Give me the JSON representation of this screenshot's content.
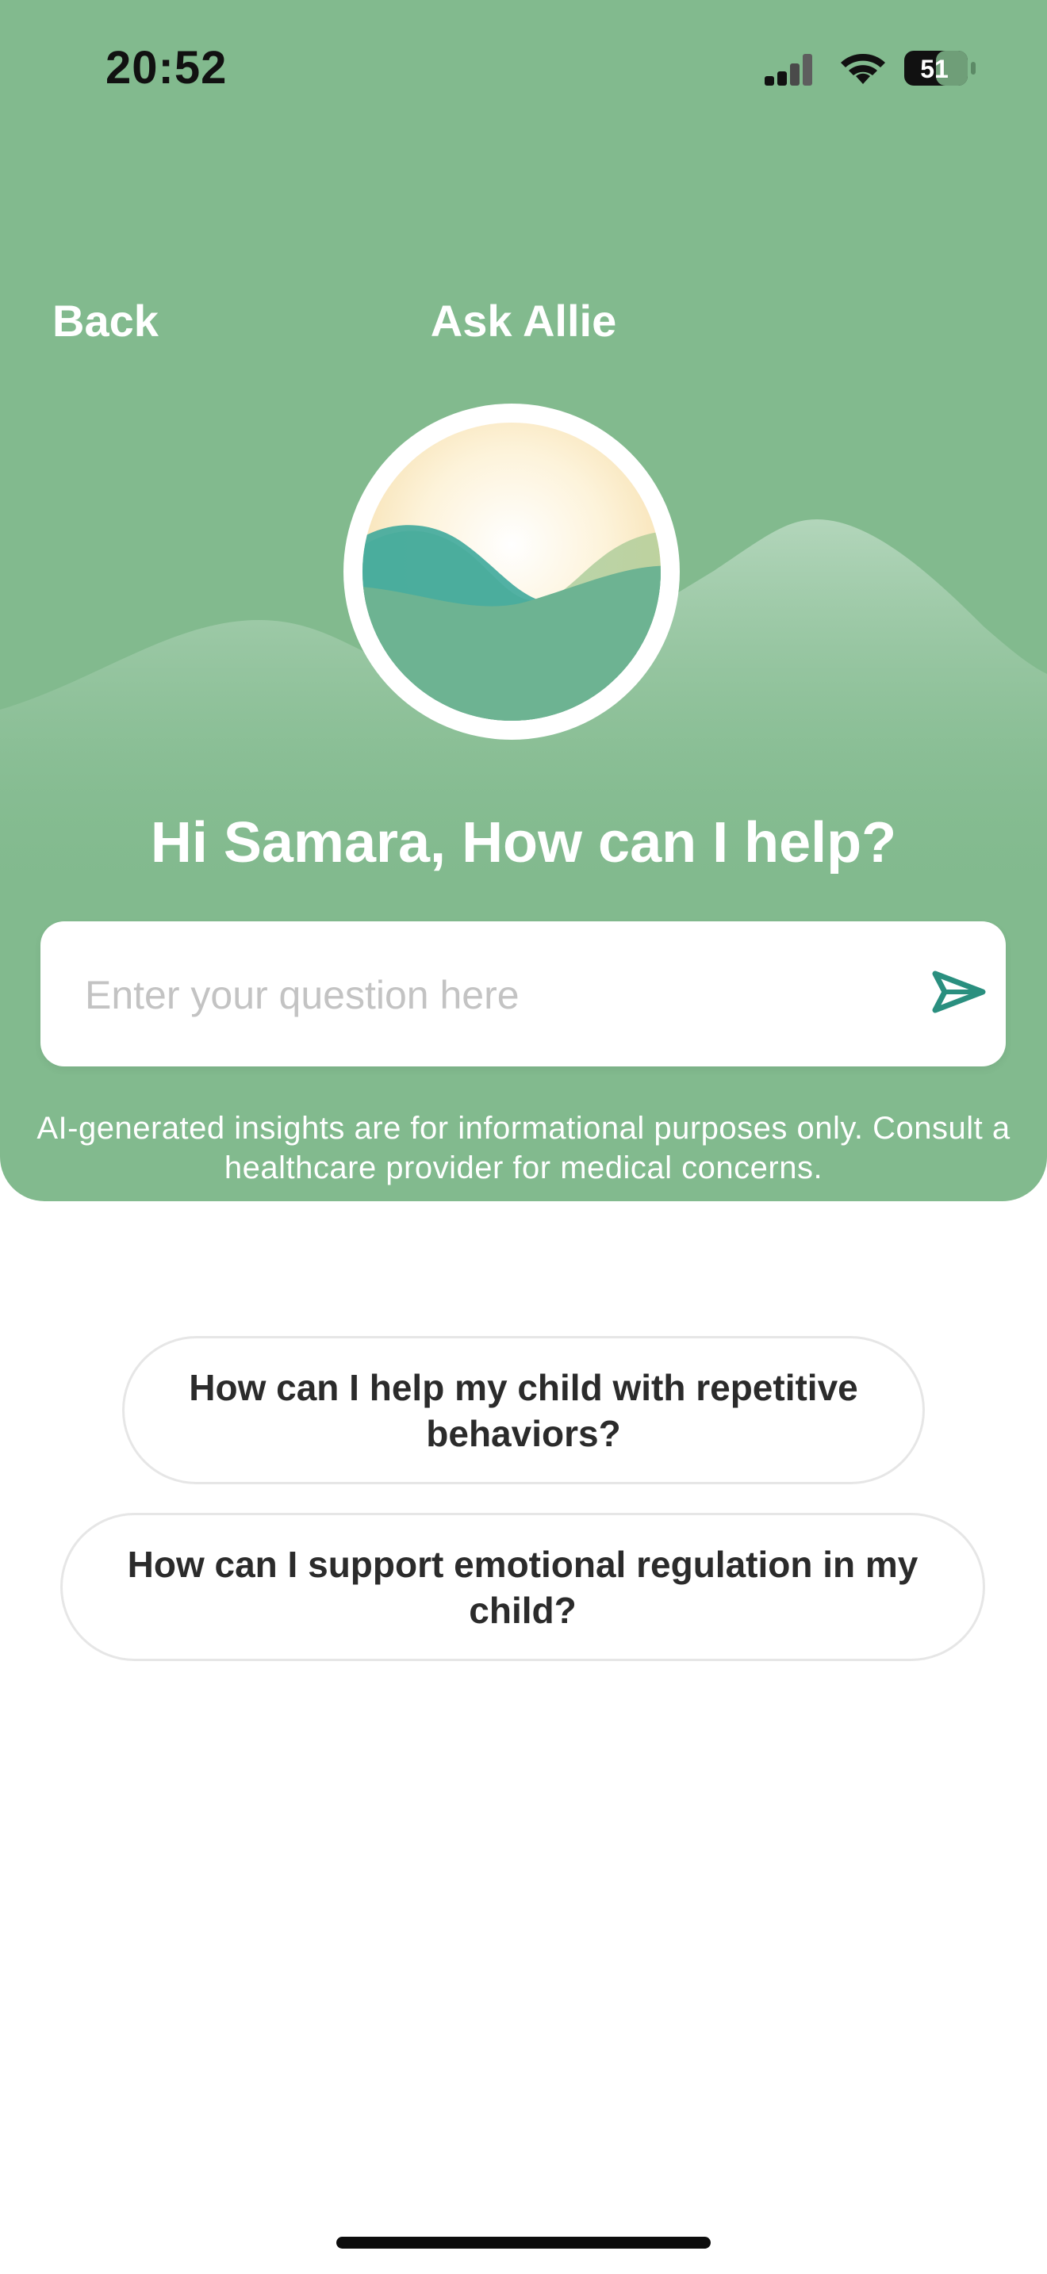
{
  "status_bar": {
    "time": "20:52",
    "battery": "51"
  },
  "nav": {
    "back_label": "Back",
    "title": "Ask Allie"
  },
  "greeting": "Hi Samara, How can I help?",
  "question_input": {
    "placeholder": "Enter your question here",
    "value": ""
  },
  "disclaimer": "AI-generated insights are for informational purposes only. Consult a healthcare provider for medical concerns.",
  "suggestions": [
    "How can I help my child with repetitive behaviors?",
    "How can I support emotional regulation in my child?"
  ],
  "icons": {
    "signal": "cellular-signal-icon",
    "wifi": "wifi-icon",
    "battery": "battery-icon",
    "logo": "allie-logo-icon",
    "send": "send-icon"
  },
  "colors": {
    "hero_green": "#82ba8e",
    "accent_teal": "#2a8f7f",
    "white": "#ffffff"
  }
}
